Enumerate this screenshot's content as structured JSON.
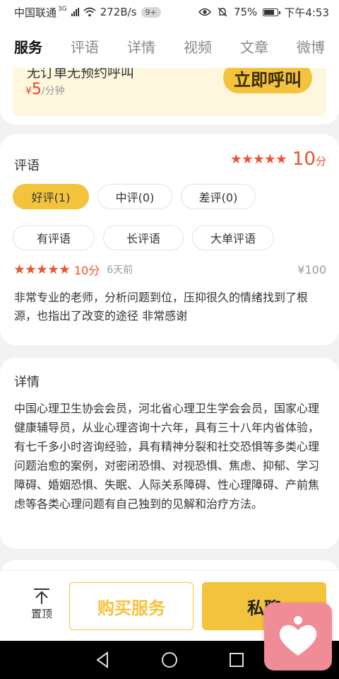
{
  "status_bar": {
    "carrier": "中国联通",
    "network": "3G",
    "speed": "272B/s",
    "notif_badge": "9+",
    "battery": "75%",
    "time": "下午4:53",
    "icons": [
      "signal-icon",
      "wifi-icon",
      "eye-icon",
      "mute-icon",
      "battery-icon"
    ]
  },
  "tabs": [
    {
      "label": "服务",
      "active": true
    },
    {
      "label": "评语",
      "active": false
    },
    {
      "label": "详情",
      "active": false
    },
    {
      "label": "视频",
      "active": false
    },
    {
      "label": "文章",
      "active": false
    },
    {
      "label": "微博",
      "active": false
    }
  ],
  "service": {
    "line": "无订单无预约呼叫",
    "currency": "¥",
    "price": "5",
    "unit": "/分钟",
    "call_button": "立即呼叫"
  },
  "reviews": {
    "title": "评语",
    "rating": 5,
    "score": "10",
    "score_unit": "分",
    "filters": [
      {
        "label": "好评(1)",
        "active": true
      },
      {
        "label": "中评(0)",
        "active": false
      },
      {
        "label": "差评(0)",
        "active": false
      }
    ],
    "tags": [
      "有评语",
      "长评语",
      "大单评语"
    ],
    "items": [
      {
        "rating": 5,
        "score": "10",
        "score_unit": "分",
        "time": "6天前",
        "amount": "¥100",
        "text": "非常专业的老师，分析问题到位，压抑很久的情绪找到了根源，也指出了改变的途径 非常感谢"
      }
    ]
  },
  "details": {
    "title": "详情",
    "text": "中国心理卫生协会会员，河北省心理卫生学会会员，国家心理健康辅导员，从业心理咨询十六年，具有三十八年内省体验，有七千多小时咨询经验，具有精神分裂和社交恐惧等多类心理问题治愈的案例，对密闭恐惧、对视恐惧、焦虑、抑郁、学习障碍、婚姻恐惧、失眠、人际关系障碍、性心理障碍、产前焦虑等各类心理问题有自己独到的见解和治疗方法。"
  },
  "bottom_bar": {
    "to_top": "置顶",
    "buy": "购买服务",
    "chat": "私聊"
  },
  "colors": {
    "accent": "#f4c33e",
    "score": "#f1502d",
    "promo_bg": "#fff7dd",
    "floating_app": "#f08c96"
  }
}
